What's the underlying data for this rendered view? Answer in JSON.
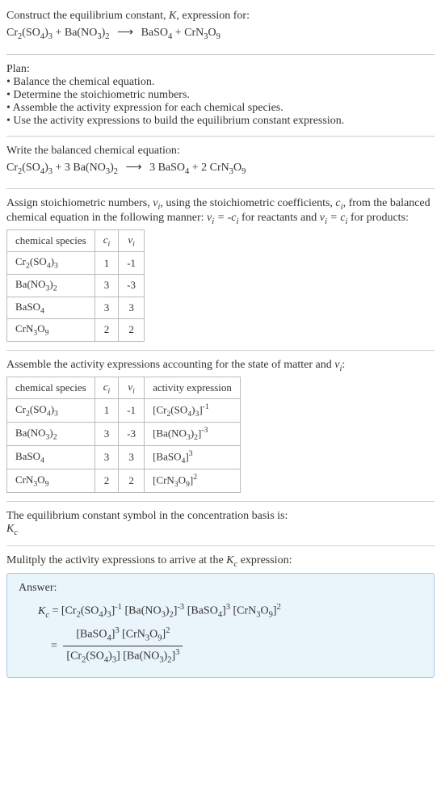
{
  "intro": {
    "line1_pre": "Construct the equilibrium constant, ",
    "line1_k": "K",
    "line1_post": ", expression for:"
  },
  "plan": {
    "heading": "Plan:",
    "items": [
      "• Balance the chemical equation.",
      "• Determine the stoichiometric numbers.",
      "• Assemble the activity expression for each chemical species.",
      "• Use the activity expressions to build the equilibrium constant expression."
    ]
  },
  "balanced": {
    "heading": "Write the balanced chemical equation:"
  },
  "stoich": {
    "text1": "Assign stoichiometric numbers, ",
    "text2": ", using the stoichiometric coefficients, ",
    "text3": ", from the balanced chemical equation in the following manner: ",
    "text4": " for reactants and ",
    "text5": " for products:"
  },
  "table1": {
    "headers": [
      "chemical species"
    ],
    "rows": [
      {
        "ci": "1",
        "vi": "-1"
      },
      {
        "ci": "3",
        "vi": "-3"
      },
      {
        "ci": "3",
        "vi": "3"
      },
      {
        "ci": "2",
        "vi": "2"
      }
    ]
  },
  "assemble": {
    "text1": "Assemble the activity expressions accounting for the state of matter and ",
    "text2": ":"
  },
  "table2": {
    "headers": [
      "chemical species",
      "activity expression"
    ],
    "rows": [
      {
        "ci": "1",
        "vi": "-1",
        "exp": "-1"
      },
      {
        "ci": "3",
        "vi": "-3",
        "exp": "-3"
      },
      {
        "ci": "3",
        "vi": "3",
        "exp": "3"
      },
      {
        "ci": "2",
        "vi": "2",
        "exp": "2"
      }
    ]
  },
  "eqsym": {
    "text": "The equilibrium constant symbol in the concentration basis is:"
  },
  "multiply": {
    "text1": "Mulitply the activity expressions to arrive at the ",
    "text2": " expression:"
  },
  "answer": {
    "label": "Answer:"
  }
}
